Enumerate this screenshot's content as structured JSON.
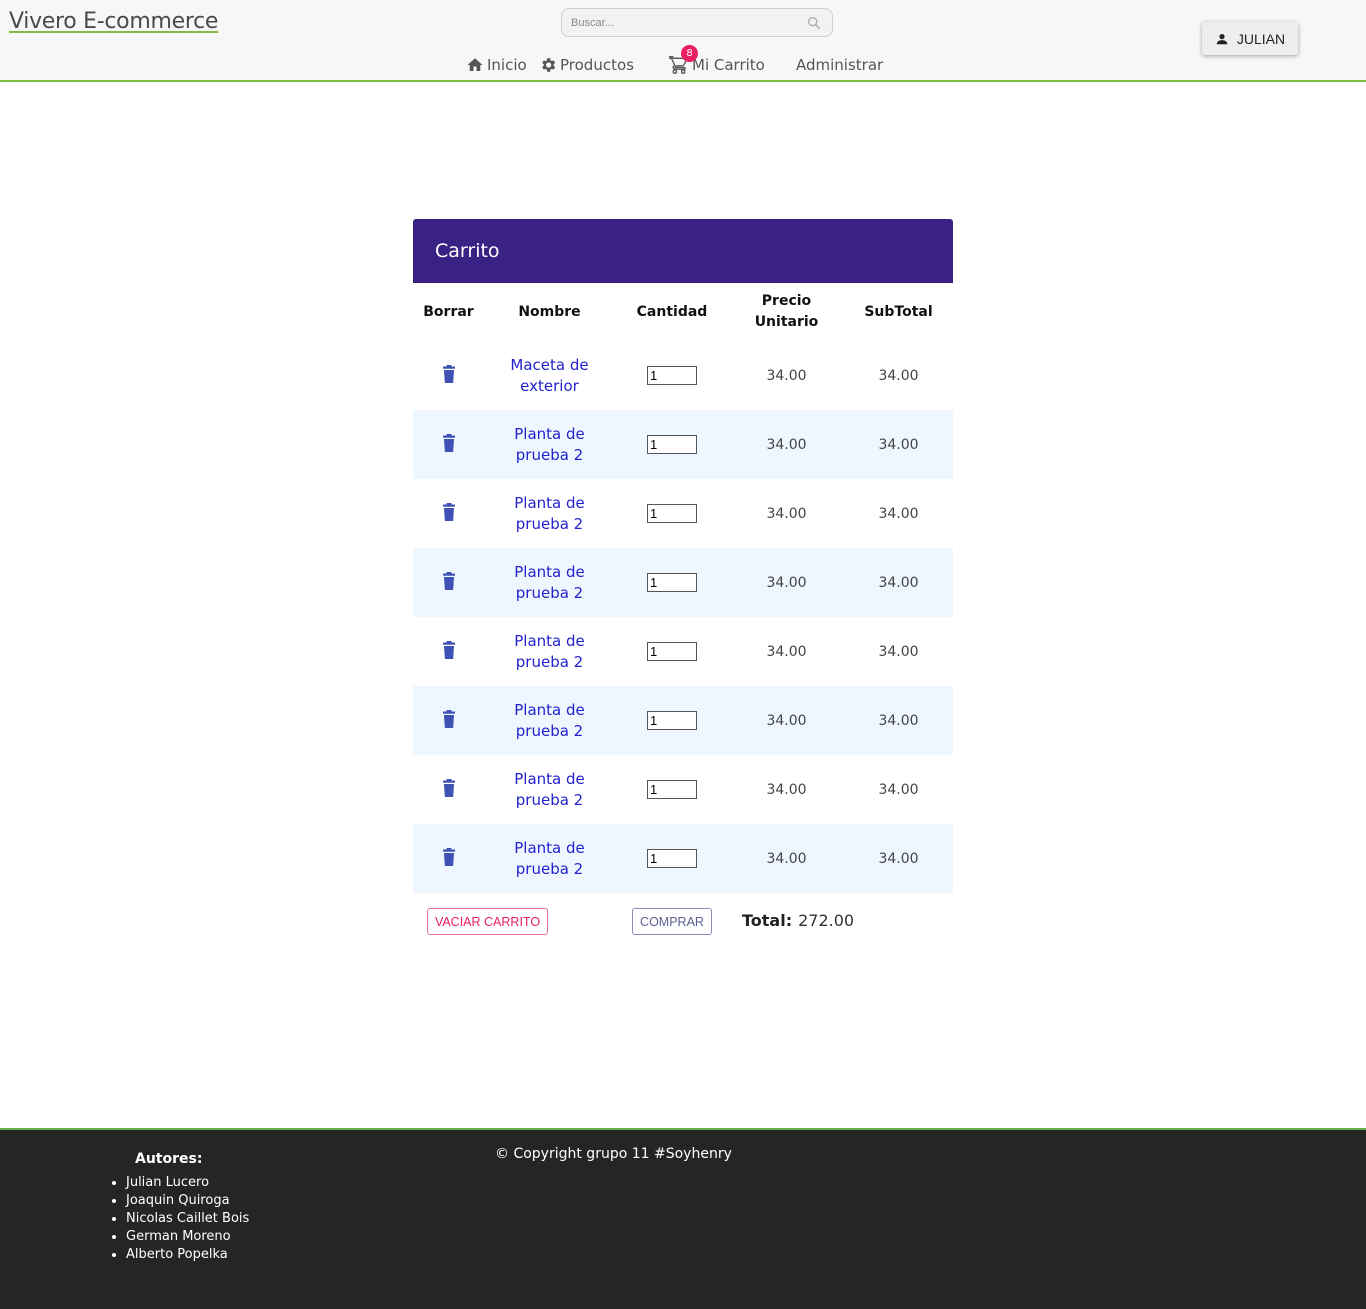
{
  "header": {
    "brand": "Vivero E-commerce",
    "search_placeholder": "Buscar...",
    "nav": {
      "inicio": "Inicio",
      "productos": "Productos",
      "carrito": "Mi Carrito",
      "cart_count": "8",
      "administrar": "Administrar"
    },
    "user": "JULIAN"
  },
  "cart": {
    "title": "Carrito",
    "columns": {
      "borrar": "Borrar",
      "nombre": "Nombre",
      "cantidad": "Cantidad",
      "precio_line1": "Precio",
      "precio_line2": "Unitario",
      "subtotal": "SubTotal"
    },
    "rows": [
      {
        "nombre": "Maceta de exterior",
        "cantidad": "1",
        "precio": "34.00",
        "subtotal": "34.00"
      },
      {
        "nombre": "Planta de prueba 2",
        "cantidad": "1",
        "precio": "34.00",
        "subtotal": "34.00"
      },
      {
        "nombre": "Planta de prueba 2",
        "cantidad": "1",
        "precio": "34.00",
        "subtotal": "34.00"
      },
      {
        "nombre": "Planta de prueba 2",
        "cantidad": "1",
        "precio": "34.00",
        "subtotal": "34.00"
      },
      {
        "nombre": "Planta de prueba 2",
        "cantidad": "1",
        "precio": "34.00",
        "subtotal": "34.00"
      },
      {
        "nombre": "Planta de prueba 2",
        "cantidad": "1",
        "precio": "34.00",
        "subtotal": "34.00"
      },
      {
        "nombre": "Planta de prueba 2",
        "cantidad": "1",
        "precio": "34.00",
        "subtotal": "34.00"
      },
      {
        "nombre": "Planta de prueba 2",
        "cantidad": "1",
        "precio": "34.00",
        "subtotal": "34.00"
      }
    ],
    "vaciar_label": "VACIAR CARRITO",
    "comprar_label": "COMPRAR",
    "total_label": "Total:",
    "total_value": "272.00"
  },
  "footer": {
    "authors_title": "Autores:",
    "authors": [
      "Julian Lucero",
      "Joaquin Quiroga",
      "Nicolas Caillet Bois",
      "German Moreno",
      "Alberto Popelka"
    ],
    "copyright": "© Copyright grupo 11 #Soyhenry"
  },
  "colors": {
    "accent_green": "#7bc043",
    "header_purple": "#3a2284",
    "badge_pink": "#e91e63",
    "trash_blue": "#3f51b5",
    "link_blue": "#2222cc",
    "row_alt": "#eef7ff",
    "footer_bg": "#252525"
  },
  "icons": {
    "home": "home-icon",
    "products": "gear-icon",
    "cart": "cart-icon",
    "user": "person-icon",
    "search": "search-icon",
    "delete": "trash-icon"
  }
}
